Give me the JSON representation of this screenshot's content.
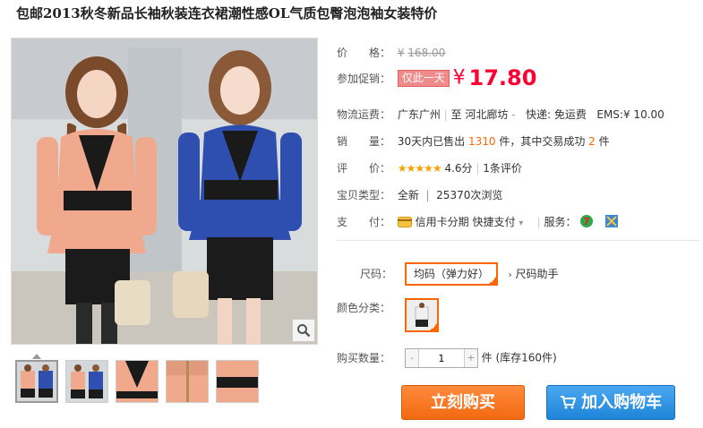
{
  "title": "包邮2013秋冬新品长袖秋装连衣裙潮性感OL气质包臀泡泡袖女装特价",
  "price": {
    "label": "价　　格：",
    "yen": "¥",
    "value": "168.00"
  },
  "promo": {
    "label": "参加促销：",
    "tag": "仅此一天",
    "yen": "¥",
    "value": "17.80"
  },
  "shipping": {
    "label": "物流运费：",
    "from": "广东广州",
    "to_word": "至",
    "to": "河北廊坊",
    "express_label": "快递:",
    "express_value": "免运费",
    "ems_label": "EMS:",
    "ems_value": "¥ 10.00"
  },
  "sales": {
    "label": "销　　量：",
    "prefix": "30天内已售出",
    "count": "1310",
    "mid": "件，其中交易成功",
    "success": "2",
    "suffix": "件"
  },
  "rating": {
    "label": "评　　价：",
    "stars": 4.6,
    "score": "4.6分",
    "reviews": "1条评价"
  },
  "condition": {
    "label": "宝贝类型：",
    "value": "全新",
    "views": "25370次浏览"
  },
  "payment": {
    "label": "支　　付：",
    "credit": "信用卡分期",
    "quick": "快捷支付",
    "service_label": "服务："
  },
  "size": {
    "label": "尺码：",
    "selected": "均码（弹力好）",
    "helper": "尺码助手"
  },
  "color": {
    "label": "颜色分类："
  },
  "quantity": {
    "label": "购买数量：",
    "value": "1",
    "minus": "-",
    "plus": "+",
    "stock": "件 (库存160件)"
  },
  "buttons": {
    "buy": "立刻购买",
    "cart": "加入购物车"
  },
  "colors": {
    "accent": "#f60",
    "price": "#f03",
    "buy": "#f26a10",
    "cart": "#1f85d9"
  }
}
